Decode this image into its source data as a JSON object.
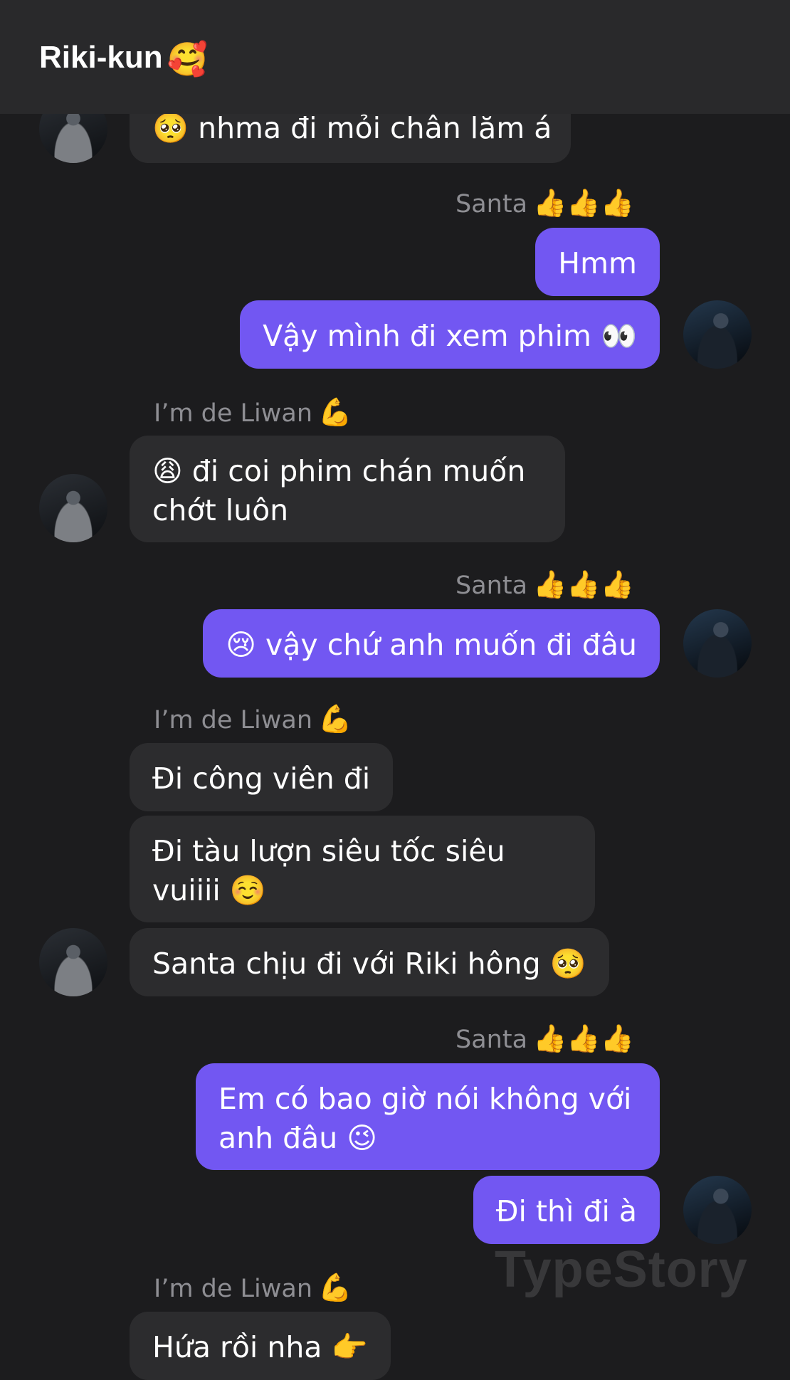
{
  "header": {
    "title": "Riki-kun",
    "title_emoji": "🥰"
  },
  "senders": {
    "other": {
      "name": "I’m de Liwan",
      "emoji": "💪"
    },
    "me": {
      "name": "Santa",
      "emoji": "👍👍👍"
    }
  },
  "messages": [
    {
      "text": "🥺 nhma đi mỏi chân lăm á"
    },
    {
      "text": "Hmm"
    },
    {
      "text": "Vậy mình đi xem phim 👀"
    },
    {
      "text": "😩 đi coi phim chán muốn chớt luôn"
    },
    {
      "text": "😢 vậy chứ anh muốn đi đâu"
    },
    {
      "text": "Đi công viên đi"
    },
    {
      "text": "Đi tàu lượn siêu tốc siêu vuiiii ☺️"
    },
    {
      "text": "Santa chịu đi với Riki hông 🥺"
    },
    {
      "text": "Em có bao giờ nói không với anh đâu 😉"
    },
    {
      "text": "Đi thì đi à"
    },
    {
      "text": "Hứa rồi nha 👉"
    }
  ],
  "watermark": "TypeStory"
}
